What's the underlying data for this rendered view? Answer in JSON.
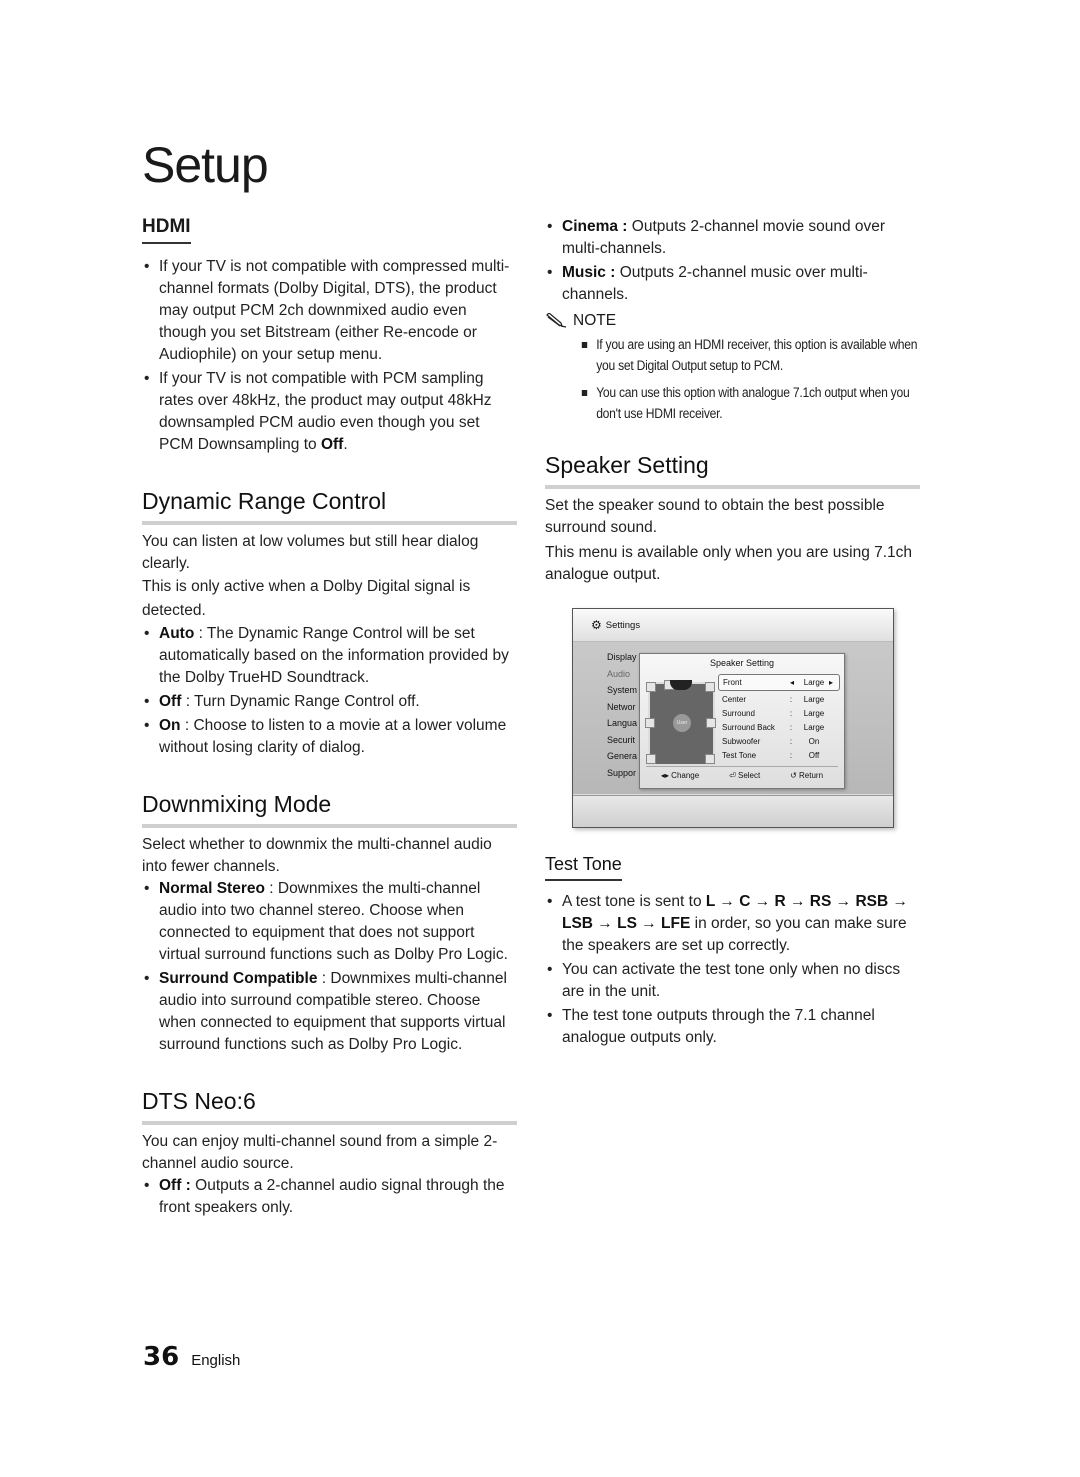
{
  "page": {
    "title": "Setup",
    "page_number": "36",
    "language": "English"
  },
  "hdmi": {
    "heading": "HDMI",
    "bullets": [
      {
        "text": "If your TV is not compatible with compressed multi-channel formats (Dolby Digital, DTS), the product may output PCM 2ch downmixed audio even though you set Bitstream (either Re-encode or Audiophile) on your setup menu."
      },
      {
        "text_before": "If your TV is not compatible with PCM sampling rates over 48kHz, the product may output 48kHz downsampled PCM audio even though you set PCM Downsampling to ",
        "bold": "Off",
        "text_after": "."
      }
    ]
  },
  "dynamic_range": {
    "heading": "Dynamic Range Control",
    "intro1": "You can listen at low volumes but still hear dialog clearly.",
    "intro2": "This is only active when a Dolby Digital signal is detected.",
    "bullets": [
      {
        "term": "Auto",
        "desc": " : The Dynamic Range Control will be set automatically based on the information provided by the Dolby TrueHD Soundtrack."
      },
      {
        "term": "Off",
        "desc": " : Turn Dynamic Range Control off."
      },
      {
        "term": "On",
        "desc": " : Choose to listen to a movie at a lower volume without losing clarity of dialog."
      }
    ]
  },
  "downmixing": {
    "heading": "Downmixing Mode",
    "intro": "Select whether to downmix the multi-channel audio into fewer channels.",
    "bullets": [
      {
        "term": "Normal Stereo",
        "desc": " : Downmixes the multi-channel audio into two channel stereo. Choose when connected to equipment that does not support virtual surround functions such as Dolby Pro Logic."
      },
      {
        "term": "Surround Compatible",
        "desc": " : Downmixes multi-channel audio into surround compatible stereo. Choose when connected to equipment that supports virtual surround functions such as Dolby Pro Logic."
      }
    ]
  },
  "dts": {
    "heading": "DTS Neo:6",
    "intro": "You can enjoy multi-channel sound from a simple 2-channel audio source.",
    "bullets": [
      {
        "term": "Off :",
        "desc": " Outputs a 2-channel audio signal through the front speakers only."
      },
      {
        "term": "Cinema :",
        "desc": " Outputs 2-channel movie sound over multi-channels."
      },
      {
        "term": "Music :",
        "desc": " Outputs 2-channel music over multi-channels."
      }
    ]
  },
  "note": {
    "label": "NOTE",
    "items": [
      "If you are using an HDMI receiver, this option is available when you set Digital Output setup to PCM.",
      "You can use this option with analogue 7.1ch output when you don't use HDMI receiver."
    ]
  },
  "speaker_setting": {
    "heading": "Speaker Setting",
    "intro1": "Set the speaker sound to obtain the best possible surround sound.",
    "intro2": "This menu is available only when you are using 7.1ch analogue output."
  },
  "screen": {
    "header": "Settings",
    "menu": [
      "Display",
      "Audio",
      "System",
      "Networ",
      "Langua",
      "Securit",
      "Genera",
      "Suppor"
    ],
    "dialog_title": "Speaker Setting",
    "user_label": "User",
    "rows": [
      {
        "label": "Front",
        "sep": "◂",
        "value": "Large",
        "arrow": "▸"
      },
      {
        "label": "Center",
        "sep": ":",
        "value": "Large"
      },
      {
        "label": "Surround",
        "sep": ":",
        "value": "Large"
      },
      {
        "label": "Surround Back",
        "sep": ":",
        "value": "Large"
      },
      {
        "label": "Subwoofer",
        "sep": ":",
        "value": "On"
      },
      {
        "label": "Test Tone",
        "sep": ":",
        "value": "Off"
      }
    ],
    "footer": {
      "change": "◂▸ Change",
      "select": "⏎ Select",
      "return": "↺ Return"
    }
  },
  "test_tone": {
    "heading": "Test Tone",
    "bullet1": {
      "before": "A test tone is sent to ",
      "sequence": "L → C → R → RS → RSB → LSB → LS → LFE",
      "after": " in order, so you can make sure the speakers are set up correctly."
    },
    "bullet2": "You can activate the test tone only when no discs are in the unit.",
    "bullet3": "The test tone outputs through the 7.1 channel analogue outputs only."
  }
}
